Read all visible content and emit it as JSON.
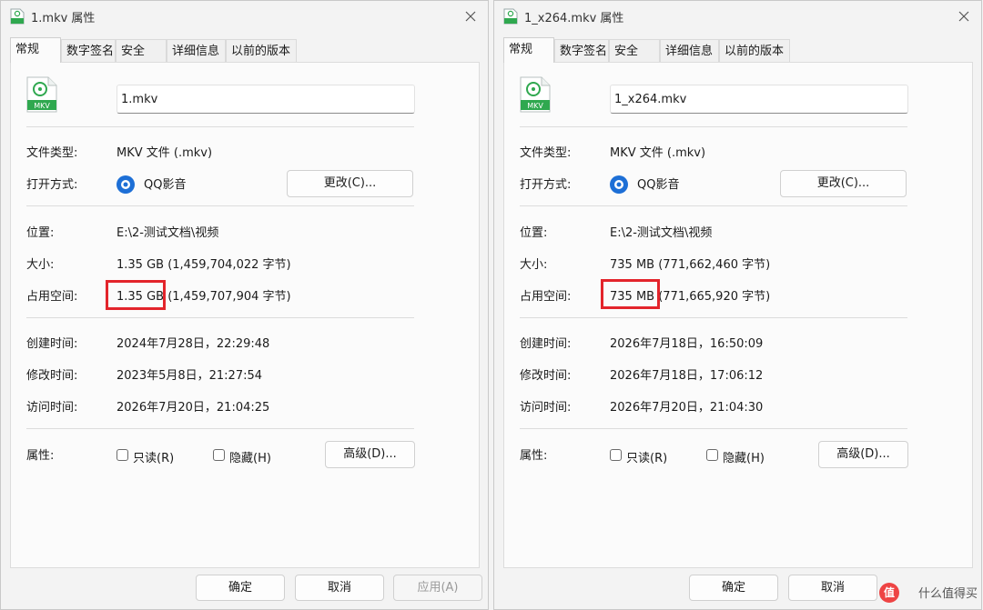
{
  "left": {
    "title": "1.mkv 属性",
    "tabs": [
      "常规",
      "数字签名",
      "安全",
      "详细信息",
      "以前的版本"
    ],
    "filename": "1.mkv",
    "icon_text": "MKV",
    "type_label": "文件类型:",
    "type_value": "MKV 文件 (.mkv)",
    "open_label": "打开方式:",
    "open_value": "QQ影音",
    "change_button": "更改(C)...",
    "location_label": "位置:",
    "location_value": "E:\\2-测试文档\\视频",
    "size_label": "大小:",
    "size_value": "1.35 GB (1,459,704,022 字节)",
    "disk_label": "占用空间:",
    "disk_value": "1.35 GB (1,459,707,904 字节)",
    "created_label": "创建时间:",
    "created_value": "2024年7月28日，22:29:48",
    "modified_label": "修改时间:",
    "modified_value": "2023年5月8日，21:27:54",
    "accessed_label": "访问时间:",
    "accessed_value": "2026年7月20日，21:04:25",
    "attrs_label": "属性:",
    "readonly_label": "只读(R)",
    "hidden_label": "隐藏(H)",
    "advanced_button": "高级(D)...",
    "ok_button": "确定",
    "cancel_button": "取消",
    "apply_button": "应用(A)"
  },
  "right": {
    "title": "1_x264.mkv 属性",
    "tabs": [
      "常规",
      "数字签名",
      "安全",
      "详细信息",
      "以前的版本"
    ],
    "filename": "1_x264.mkv",
    "icon_text": "MKV",
    "type_label": "文件类型:",
    "type_value": "MKV 文件 (.mkv)",
    "open_label": "打开方式:",
    "open_value": "QQ影音",
    "change_button": "更改(C)...",
    "location_label": "位置:",
    "location_value": "E:\\2-测试文档\\视频",
    "size_label": "大小:",
    "size_value": "735 MB (771,662,460 字节)",
    "disk_label": "占用空间:",
    "disk_value": "735 MB (771,665,920 字节)",
    "created_label": "创建时间:",
    "created_value": "2026年7月18日，16:50:09",
    "modified_label": "修改时间:",
    "modified_value": "2026年7月18日，17:06:12",
    "accessed_label": "访问时间:",
    "accessed_value": "2026年7月20日，21:04:30",
    "attrs_label": "属性:",
    "readonly_label": "只读(R)",
    "hidden_label": "隐藏(H)",
    "advanced_button": "高级(D)...",
    "ok_button": "确定",
    "cancel_button": "取消"
  },
  "watermark": "什么值得买",
  "colors": {
    "highlight": "#e3242b",
    "mkv_green": "#2fa84f",
    "qq_blue": "#1d6fd6"
  }
}
